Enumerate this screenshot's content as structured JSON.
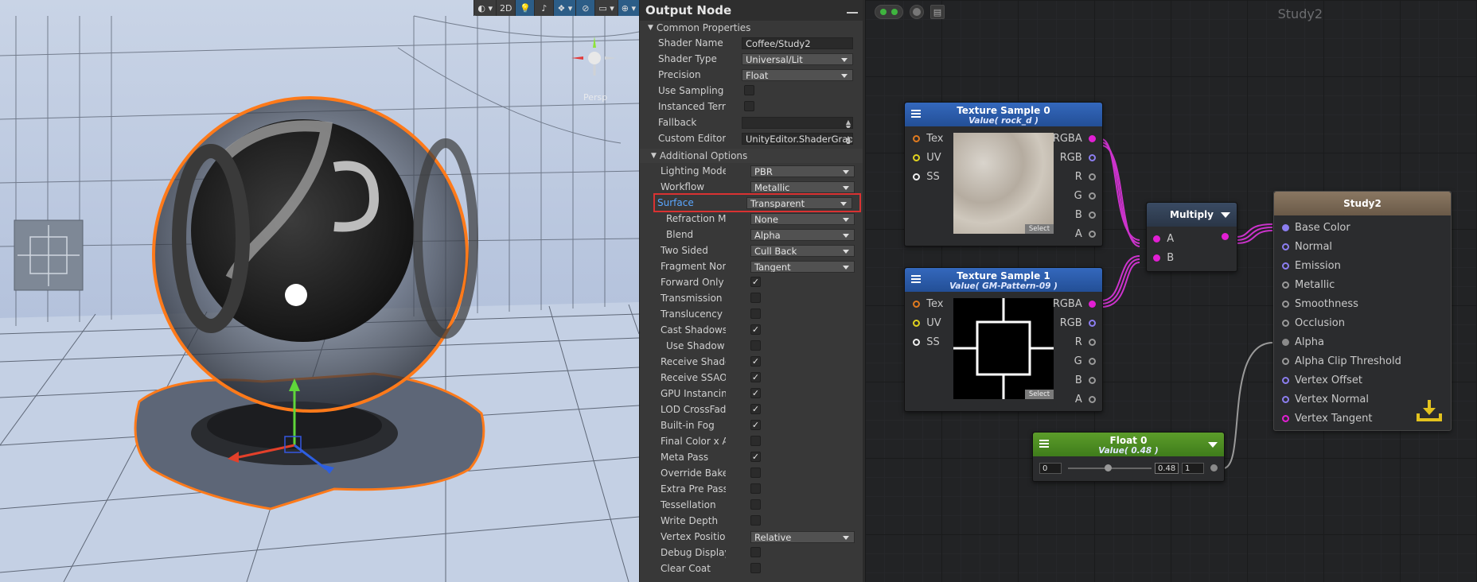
{
  "viewport": {
    "toolbar": [
      {
        "icon": "shading-sphere-icon",
        "label": "",
        "dropdown": true
      },
      {
        "icon": "",
        "label": "2D",
        "dropdown": false
      },
      {
        "icon": "light-bulb-icon",
        "label": "",
        "dropdown": false,
        "active": true
      },
      {
        "icon": "audio-icon",
        "label": "",
        "dropdown": false
      },
      {
        "icon": "effects-icon",
        "label": "",
        "dropdown": true
      },
      {
        "icon": "hidden-objects-icon",
        "label": "",
        "dropdown": false
      },
      {
        "icon": "camera-icon",
        "label": "",
        "dropdown": true
      },
      {
        "icon": "gizmos-icon",
        "label": "",
        "dropdown": true
      }
    ],
    "persp_label": "Persp"
  },
  "inspector": {
    "title": "Output Node",
    "common_section": "Common Properties",
    "common_rows": [
      {
        "label": "Shader Name",
        "type": "text",
        "value": "Coffee/Study2"
      },
      {
        "label": "Shader Type",
        "type": "dropdown",
        "value": "Universal/Lit"
      },
      {
        "label": "Precision",
        "type": "dropdown",
        "value": "Float"
      },
      {
        "label": "Use Sampling Macros",
        "type": "check",
        "checked": false
      },
      {
        "label": "Instanced Terrain",
        "type": "check",
        "checked": false
      },
      {
        "label": "Fallback",
        "type": "text",
        "value": "",
        "stepper": true
      },
      {
        "label": "Custom Editor",
        "type": "text",
        "value": "UnityEditor.ShaderGraph",
        "stepper": true
      }
    ],
    "additional_section": "Additional Options",
    "additional_rows": [
      {
        "label": "Lighting Model",
        "type": "dropdown",
        "value": "PBR"
      },
      {
        "label": "Workflow",
        "type": "dropdown",
        "value": "Metallic"
      },
      {
        "label": "Surface",
        "type": "dropdown",
        "value": "Transparent",
        "highlight": true
      },
      {
        "label": "Refraction Model",
        "type": "dropdown",
        "value": "None",
        "indent": true
      },
      {
        "label": "Blend",
        "type": "dropdown",
        "value": "Alpha",
        "indent": true
      },
      {
        "label": "Two Sided",
        "type": "dropdown",
        "value": "Cull Back"
      },
      {
        "label": "Fragment Normal Space",
        "type": "dropdown",
        "value": "Tangent"
      },
      {
        "label": "Forward Only",
        "type": "check",
        "checked": true
      },
      {
        "label": "Transmission",
        "type": "check",
        "checked": false
      },
      {
        "label": "Translucency",
        "type": "check",
        "checked": false
      },
      {
        "label": "Cast Shadows",
        "type": "check",
        "checked": true
      },
      {
        "label": "Use Shadow Threshold",
        "type": "check",
        "checked": false,
        "indent": true
      },
      {
        "label": "Receive Shadows",
        "type": "check",
        "checked": true
      },
      {
        "label": "Receive SSAO",
        "type": "check",
        "checked": true
      },
      {
        "label": "GPU Instancing",
        "type": "check",
        "checked": true
      },
      {
        "label": "LOD CrossFade",
        "type": "check",
        "checked": true
      },
      {
        "label": "Built-in Fog",
        "type": "check",
        "checked": true
      },
      {
        "label": "Final Color x Alpha",
        "type": "check",
        "checked": false
      },
      {
        "label": "Meta Pass",
        "type": "check",
        "checked": true
      },
      {
        "label": "Override Baked GI",
        "type": "check",
        "checked": false
      },
      {
        "label": "Extra Pre Pass",
        "type": "check",
        "checked": false
      },
      {
        "label": "Tessellation",
        "type": "check",
        "checked": false
      },
      {
        "label": "Write Depth",
        "type": "check",
        "checked": false
      },
      {
        "label": "Vertex Position",
        "type": "dropdown",
        "value": "Relative"
      },
      {
        "label": "Debug Display",
        "type": "check",
        "checked": false
      },
      {
        "label": "Clear Coat",
        "type": "check",
        "checked": false
      }
    ],
    "colors": {
      "highlight_border": "#d93232",
      "surface_label": "#5aa7ff"
    }
  },
  "graph": {
    "title": "Study2",
    "tex0": {
      "title": "Texture Sample 0",
      "subtitle": "Value( rock_d )",
      "inputs": [
        "Tex",
        "UV",
        "SS"
      ],
      "outputs": [
        "RGBA",
        "RGB",
        "R",
        "G",
        "B",
        "A"
      ],
      "select": "Select"
    },
    "tex1": {
      "title": "Texture Sample 1",
      "subtitle": "Value( GM-Pattern-09 )",
      "inputs": [
        "Tex",
        "UV",
        "SS"
      ],
      "outputs": [
        "RGBA",
        "RGB",
        "R",
        "G",
        "B",
        "A"
      ],
      "select": "Select"
    },
    "multiply": {
      "title": "Multiply",
      "inputs": [
        "A",
        "B"
      ]
    },
    "float0": {
      "title": "Float 0",
      "subtitle": "Value( 0.48 )",
      "min": "0",
      "value": "0.48",
      "max": "1",
      "slider_fraction": 0.48
    },
    "output": {
      "title": "Study2",
      "ports": [
        "Base Color",
        "Normal",
        "Emission",
        "Metallic",
        "Smoothness",
        "Occlusion",
        "Alpha",
        "Alpha Clip Threshold",
        "Vertex Offset",
        "Vertex Normal",
        "Vertex Tangent"
      ]
    },
    "colors": {
      "wire": "#cc33cc",
      "header_tex": "#2a5aa6",
      "header_mul": "#2f3e52",
      "header_float": "#4c8a22",
      "header_out": "#7d6b55"
    }
  }
}
